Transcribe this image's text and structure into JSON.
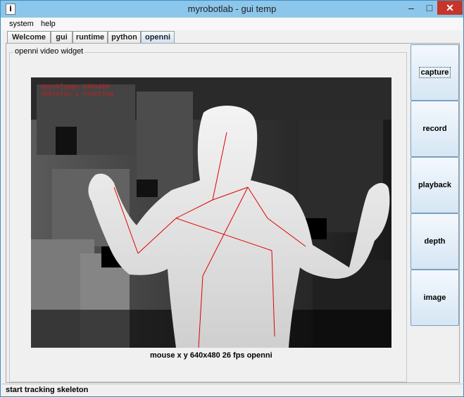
{
  "window": {
    "title": "myrobotlab - gui temp",
    "icon_glyph": "i",
    "minimize_glyph": "–",
    "maximize_glyph": "□",
    "close_glyph": "✕"
  },
  "menu": [
    "system",
    "help"
  ],
  "tabs": [
    {
      "label": "Welcome",
      "active": false
    },
    {
      "label": "gui",
      "active": false
    },
    {
      "label": "runtime",
      "active": false
    },
    {
      "label": "python",
      "active": false
    },
    {
      "label": "openni",
      "active": true
    }
  ],
  "panel": {
    "group_title": "openni  video widget",
    "caption": "mouse x y  640x480  26 fps  openni",
    "overlay_text": [
      "depthImage 640x480",
      "skeleton 1 tracking"
    ]
  },
  "side_buttons": [
    "capture",
    "record",
    "playback",
    "depth",
    "image"
  ],
  "status": "start tracking skeleton",
  "colors": {
    "title_bar": "#8cc6ea",
    "close_button": "#c7352a",
    "skeleton": "#e00000",
    "button_gradient_bottom": "#d6e6f4"
  }
}
